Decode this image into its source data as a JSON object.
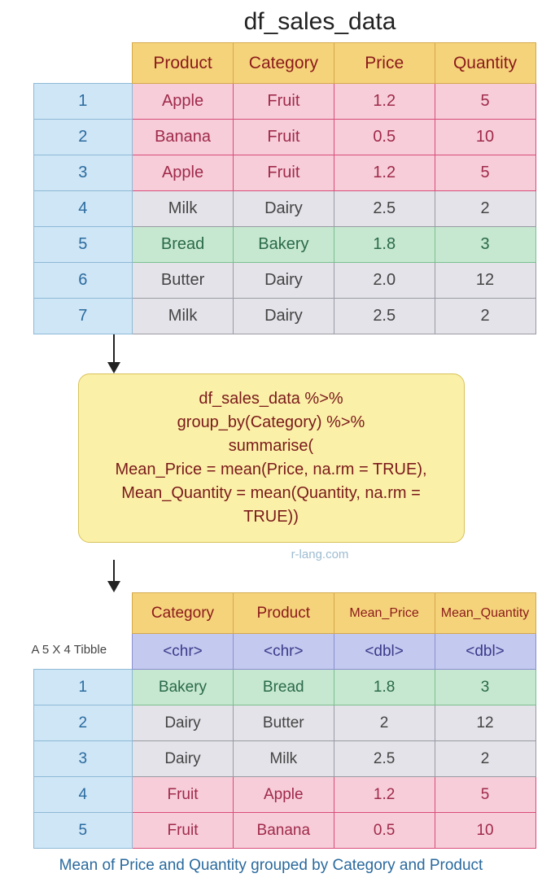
{
  "title": "df_sales_data",
  "table1": {
    "headers": [
      "Product",
      "Category",
      "Price",
      "Quantity"
    ],
    "rows": [
      {
        "idx": "1",
        "color": "pink",
        "cells": [
          "Apple",
          "Fruit",
          "1.2",
          "5"
        ]
      },
      {
        "idx": "2",
        "color": "pink",
        "cells": [
          "Banana",
          "Fruit",
          "0.5",
          "10"
        ]
      },
      {
        "idx": "3",
        "color": "pink",
        "cells": [
          "Apple",
          "Fruit",
          "1.2",
          "5"
        ]
      },
      {
        "idx": "4",
        "color": "gray",
        "cells": [
          "Milk",
          "Dairy",
          "2.5",
          "2"
        ]
      },
      {
        "idx": "5",
        "color": "green",
        "cells": [
          "Bread",
          "Bakery",
          "1.8",
          "3"
        ]
      },
      {
        "idx": "6",
        "color": "gray",
        "cells": [
          "Butter",
          "Dairy",
          "2.0",
          "12"
        ]
      },
      {
        "idx": "7",
        "color": "gray",
        "cells": [
          "Milk",
          "Dairy",
          "2.5",
          "2"
        ]
      }
    ]
  },
  "code": {
    "line1": "df_sales_data %>%",
    "line2": "group_by(Category) %>%",
    "line3": "summarise(",
    "line4": "Mean_Price = mean(Price, na.rm = TRUE),",
    "line5": "Mean_Quantity = mean(Quantity, na.rm = TRUE))"
  },
  "watermark": "r-lang.com",
  "tibble_label": "A 5 X 4  Tibble",
  "table2": {
    "headers": [
      "Category",
      "Product",
      "Mean_Price",
      "Mean_Quantity"
    ],
    "types": [
      "<chr>",
      "<chr>",
      "<dbl>",
      "<dbl>"
    ],
    "rows": [
      {
        "idx": "1",
        "color": "green",
        "cells": [
          "Bakery",
          "Bread",
          "1.8",
          "3"
        ]
      },
      {
        "idx": "2",
        "color": "gray",
        "cells": [
          "Dairy",
          "Butter",
          "2",
          "12"
        ]
      },
      {
        "idx": "3",
        "color": "gray",
        "cells": [
          "Dairy",
          "Milk",
          "2.5",
          "2"
        ]
      },
      {
        "idx": "4",
        "color": "pink",
        "cells": [
          "Fruit",
          "Apple",
          "1.2",
          "5"
        ]
      },
      {
        "idx": "5",
        "color": "pink",
        "cells": [
          "Fruit",
          "Banana",
          "0.5",
          "10"
        ]
      }
    ]
  },
  "caption": "Mean of Price and Quantity grouped by Category and Product"
}
